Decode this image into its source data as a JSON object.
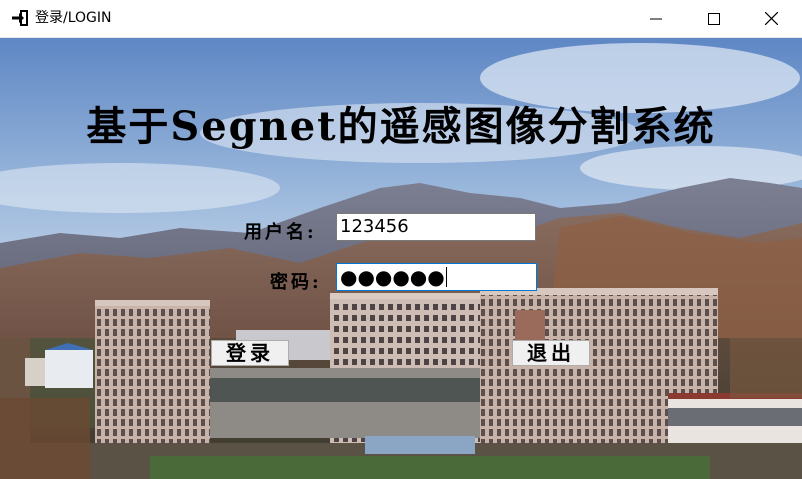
{
  "window": {
    "title": "登录/LOGIN",
    "icon": "login-icon",
    "controls": [
      "minimize-icon",
      "maximize-icon",
      "close-icon"
    ]
  },
  "app": {
    "title": "基于Segnet的遥感图像分割系统"
  },
  "form": {
    "username_label": "用户名:",
    "username_value": "123456",
    "password_label": "密码:",
    "password_display": "●●●●●●",
    "login_label": "登录",
    "exit_label": "退出"
  },
  "colors": {
    "input_focus_border": "#0078d7",
    "titlebar_bg": "#ffffff"
  }
}
